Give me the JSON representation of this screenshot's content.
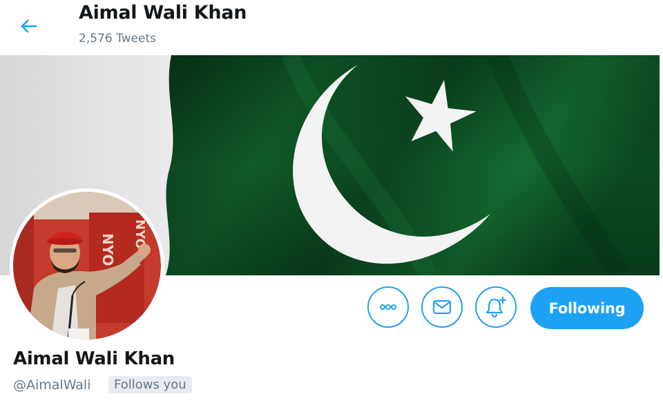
{
  "header": {
    "title": "Aimal Wali Khan",
    "tweet_count": "2,576 Tweets"
  },
  "banner": {
    "description_icon": "pakistan-flag-image"
  },
  "actions": {
    "more_icon": "more-icon",
    "message_icon": "envelope-icon",
    "notify_icon": "bell-plus-icon",
    "following_label": "Following"
  },
  "avatar": {
    "sign_text": "NYO"
  },
  "profile": {
    "name": "Aimal Wali Khan",
    "handle": "@AimalWali",
    "follows_you": "Follows you"
  },
  "colors": {
    "accent": "#1da1f2",
    "flag_green": "#0b4a22",
    "flag_white": "#e9e9e9",
    "text_primary": "#14171a",
    "text_secondary": "#657786"
  }
}
